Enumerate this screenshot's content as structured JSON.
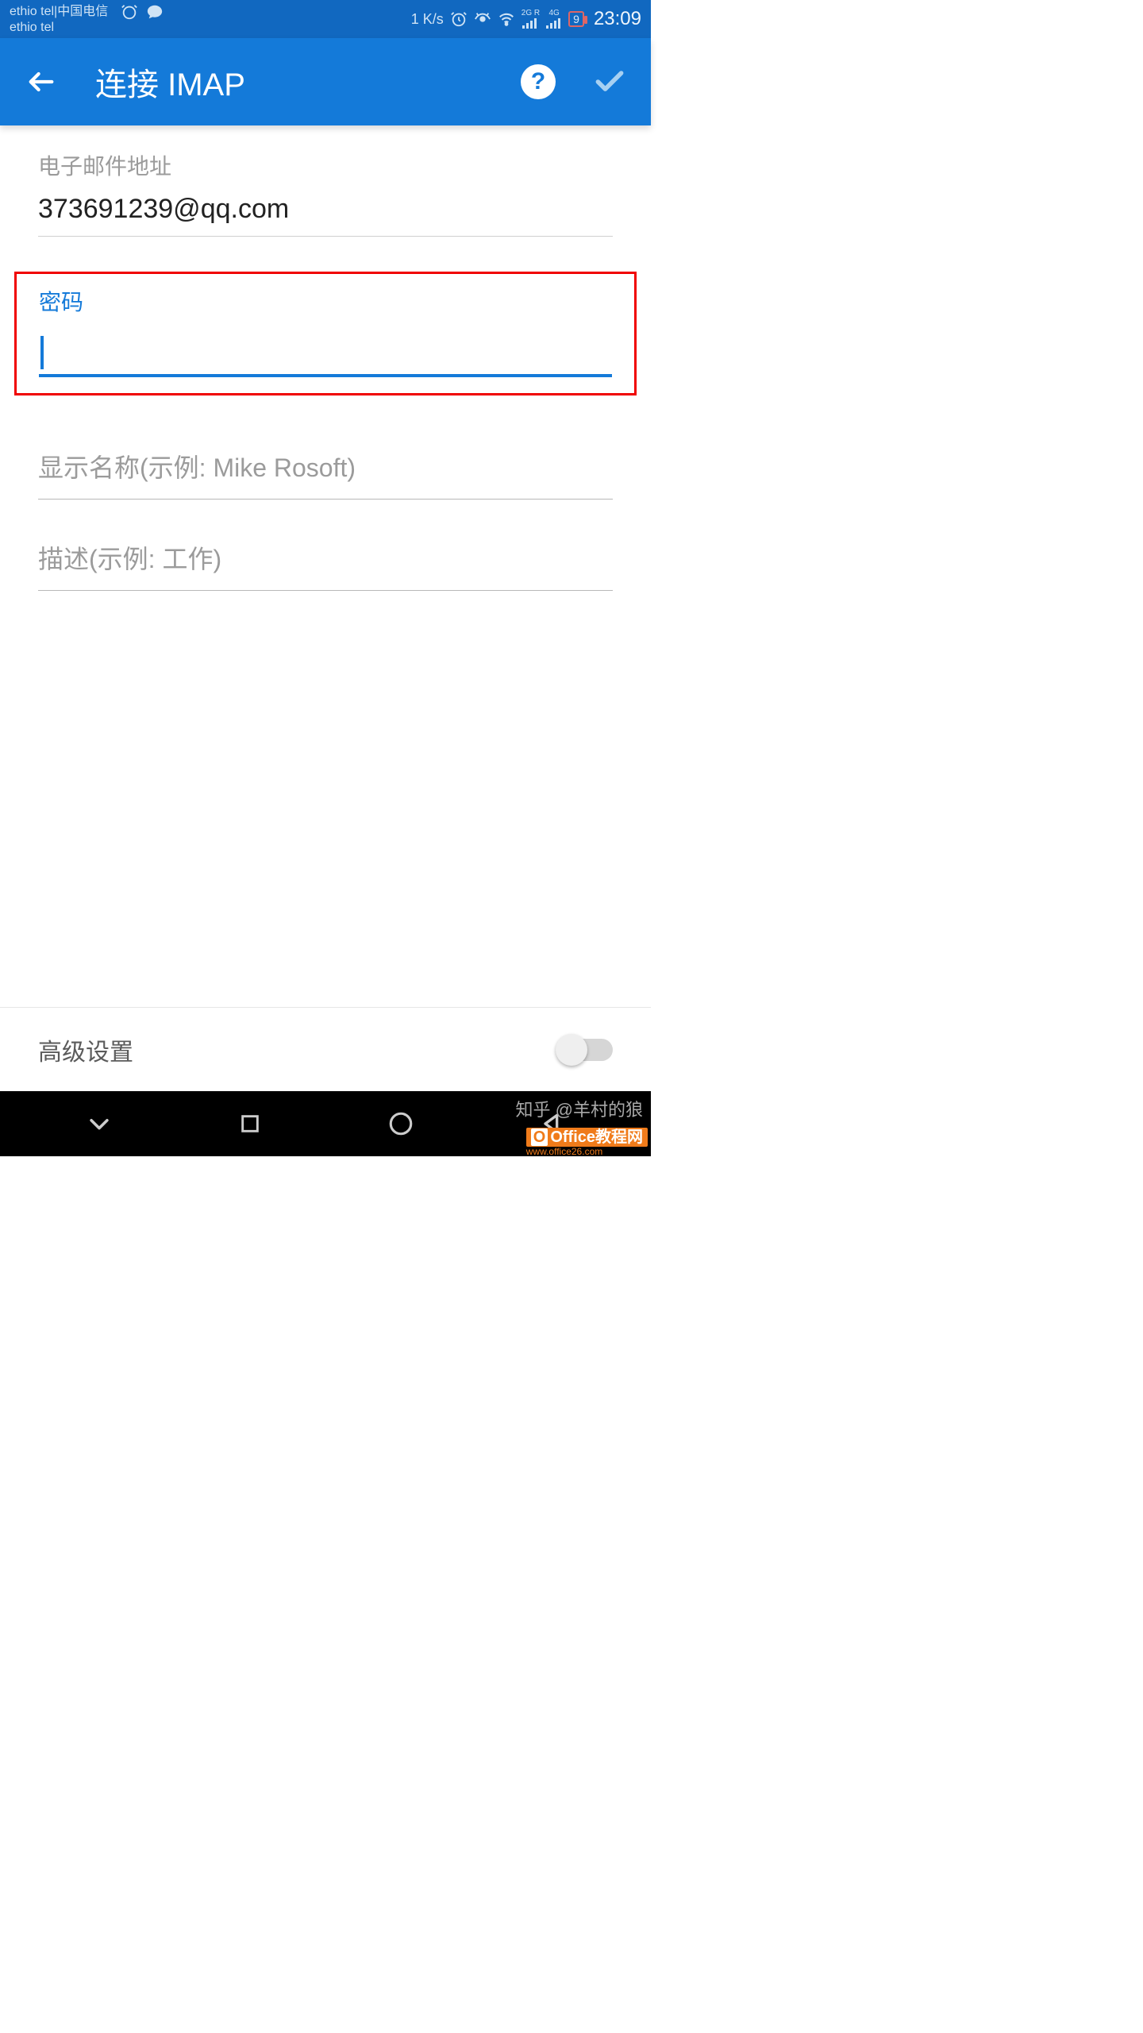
{
  "status": {
    "carrier_line1": "ethio tel|中国电信",
    "carrier_line2": "ethio tel",
    "speed": "1 K/s",
    "net2g": "2G R",
    "net4g": "4G",
    "battery": "9",
    "time": "23:09"
  },
  "appbar": {
    "title": "连接 IMAP",
    "help": "?"
  },
  "form": {
    "email_label": "电子邮件地址",
    "email_value": "373691239@qq.com",
    "password_label": "密码",
    "display_name_placeholder": "显示名称(示例: Mike Rosoft)",
    "description_placeholder": "描述(示例: 工作)"
  },
  "advanced": {
    "label": "高级设置",
    "enabled": false
  },
  "watermark": {
    "zhihu": "知乎 @羊村的狼",
    "office_brand": "Office教程网",
    "office_url": "www.office26.com"
  }
}
